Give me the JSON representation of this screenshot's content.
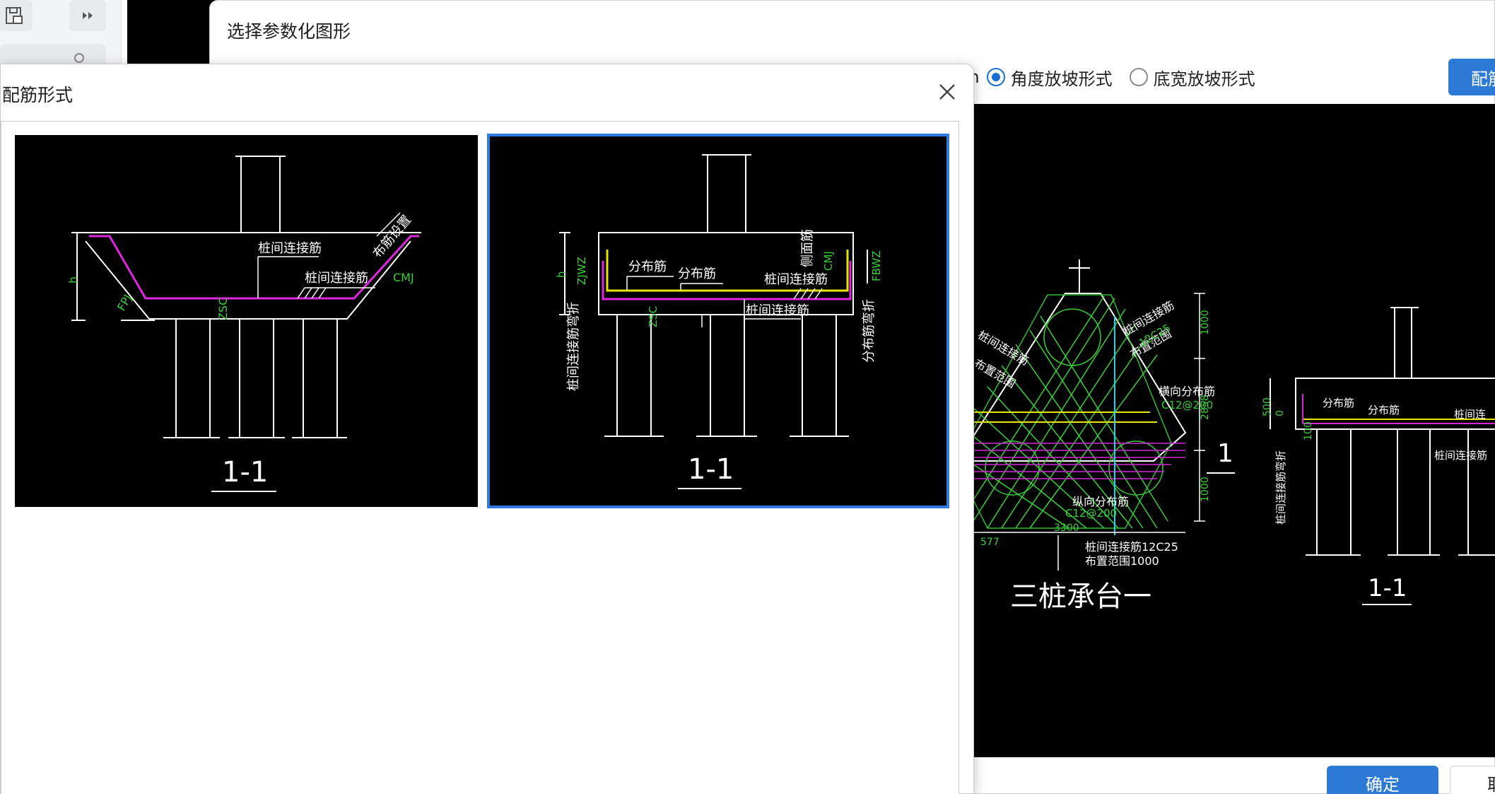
{
  "parent_dialog": {
    "title": "选择参数化图形",
    "unit_partial": "nm",
    "radio_options": [
      {
        "label": "角度放坡形式",
        "selected": true
      },
      {
        "label": "底宽放坡形式",
        "selected": false
      }
    ],
    "top_button_partial": "配筋",
    "ok_label": "确定",
    "cancel_partial": "取"
  },
  "front_dialog": {
    "title": "配筋形式",
    "thumbnails": [
      {
        "selected": false,
        "section_label": "1-1",
        "labels": {
          "rebar1": "桩间连接筋",
          "rebar2": "桩间连接筋",
          "slope": "布筋设置",
          "cmj": "CMJ",
          "fpj": "FPJ",
          "zsc": "ZSC",
          "h": "h"
        }
      },
      {
        "selected": true,
        "section_label": "1-1",
        "labels": {
          "dist1": "分布筋",
          "dist2": "分布筋",
          "rebar_top": "桩间连接筋",
          "rebar_bottom": "桩间连接筋",
          "side": "侧面筋",
          "cmj": "CMJ",
          "zjwz": "ZJWZ",
          "fbwz": "FBWZ",
          "zsc": "ZSC",
          "h": "h",
          "left_vertical": "桩间连接筋弯折",
          "right_vertical": "分布筋弯折"
        }
      }
    ]
  },
  "preview": {
    "plan_title": "三桩承台一",
    "section_label": "1-1",
    "section_marker": "1",
    "labels": {
      "rebar_a": "桩间连接筋",
      "rebar_b": "桩间连接筋",
      "range_a": "布置范围",
      "range_b": "布置范围",
      "spec_a": "12C25",
      "trans": "横向分布筋",
      "trans_spec": "C12@200",
      "long": "纵向分布筋",
      "long_spec": "C12@200",
      "bottom_rebar": "桩间连接筋12C25",
      "bottom_range": "布置范围1000",
      "dim_1000a": "1000",
      "dim_2858": "2858",
      "dim_1000b": "1000",
      "dim_3300": "3300",
      "dim_577": "577",
      "dim_500": "500",
      "dim_0": "0",
      "dim_100": "100",
      "sec_dist1": "分布筋",
      "sec_dist2": "分布筋",
      "sec_rebar": "桩间连",
      "sec_rebar2": "桩间连接筋",
      "sec_vertical": "桩间连接筋弯折"
    }
  }
}
